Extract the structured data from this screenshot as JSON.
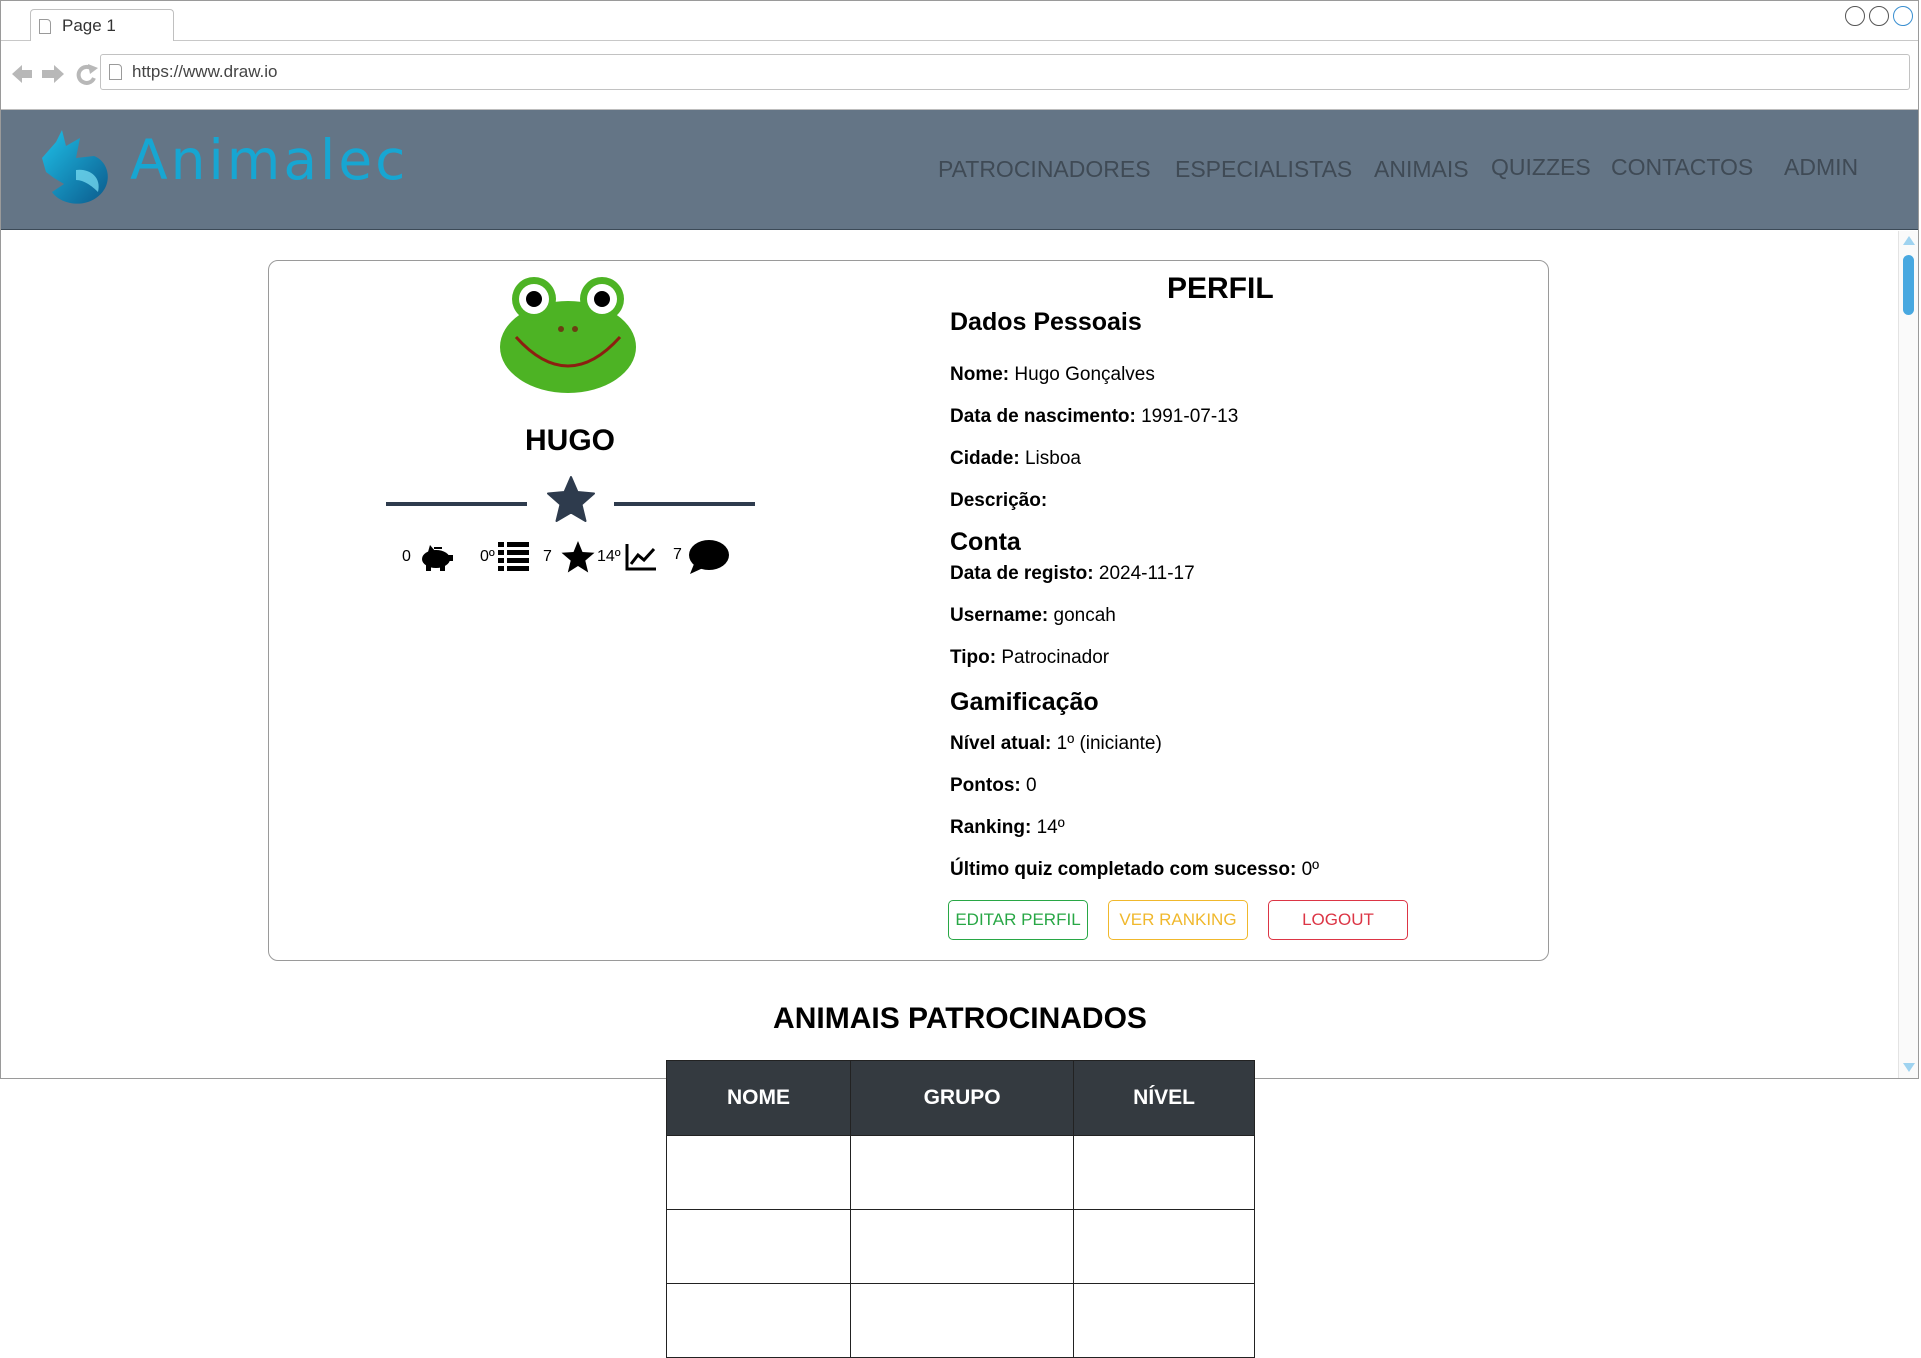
{
  "browser": {
    "tab_title": "Page 1",
    "url": "https://www.draw.io"
  },
  "header": {
    "brand": "Animalec",
    "menu": [
      "PATROCINADORES",
      "ESPECIALISTAS",
      "ANIMAIS",
      "QUIZZES",
      "CONTACTOS",
      "ADMIN"
    ]
  },
  "profile": {
    "name": "HUGO",
    "stats": {
      "points": "0",
      "last_quiz": "0º",
      "level_stars": "7",
      "ranking": "14º",
      "comments": "7"
    },
    "title": "PERFIL",
    "sections": {
      "personal": {
        "heading": "Dados Pessoais",
        "fields": [
          {
            "label": "Nome:",
            "value": "Hugo Gonçalves"
          },
          {
            "label": "Data de nascimento:",
            "value": "1991-07-13"
          },
          {
            "label": "Cidade:",
            "value": "Lisboa"
          },
          {
            "label": "Descrição:",
            "value": ""
          }
        ]
      },
      "account": {
        "heading": "Conta",
        "fields": [
          {
            "label": "Data de registo:",
            "value": "2024-11-17"
          },
          {
            "label": "Username:",
            "value": "goncah"
          },
          {
            "label": "Tipo:",
            "value": "Patrocinador"
          }
        ]
      },
      "gamification": {
        "heading": "Gamificação",
        "fields": [
          {
            "label": "Nível atual:",
            "value": "1º (iniciante)"
          },
          {
            "label": "Pontos:",
            "value": "0"
          },
          {
            "label": "Ranking:",
            "value": "14º"
          },
          {
            "label": "Último quiz completado com sucesso:",
            "value": "0º"
          }
        ]
      }
    },
    "buttons": {
      "edit": "EDITAR PERFIL",
      "ranking": "VER RANKING",
      "logout": "LOGOUT"
    }
  },
  "sponsored": {
    "title": "ANIMAIS PATROCINADOS",
    "columns": [
      "NOME",
      "GRUPO",
      "NÍVEL"
    ],
    "rows": [
      [
        "",
        "",
        ""
      ],
      [
        "",
        "",
        ""
      ],
      [
        "",
        "",
        ""
      ]
    ]
  },
  "colors": {
    "header_bg": "#647586",
    "brand": "#17a6d2",
    "edit": "#28a745",
    "ranking": "#f0b82c",
    "logout": "#dc3545",
    "table_header": "#343a40"
  }
}
